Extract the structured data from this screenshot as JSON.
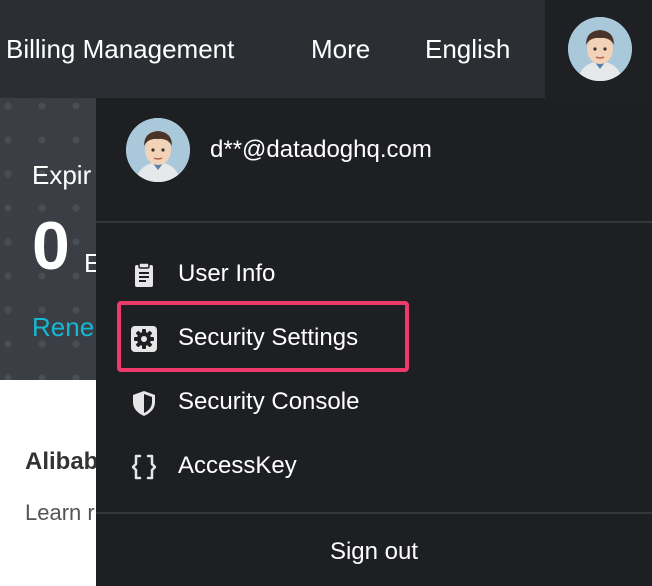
{
  "topbar": {
    "billing": "Billing Management",
    "more": "More",
    "language": "English"
  },
  "dashboard": {
    "expire_label": "Expir",
    "count": "0",
    "count_suffix": "E",
    "renew_link": "Rene",
    "section_title": "Alibab",
    "learn_text": "Learn r"
  },
  "dropdown": {
    "email": "d**@datadoghq.com",
    "items": [
      {
        "label": "User Info",
        "icon": "clipboard-icon"
      },
      {
        "label": "Security Settings",
        "icon": "gear-icon"
      },
      {
        "label": "Security Console",
        "icon": "shield-icon"
      },
      {
        "label": "AccessKey",
        "icon": "code-braces-icon"
      }
    ],
    "signout": "Sign out"
  },
  "colors": {
    "topbar": "#2b2e33",
    "dropdown": "#1d1f23",
    "highlight": "#ee3a6a",
    "link": "#15b8d3"
  }
}
